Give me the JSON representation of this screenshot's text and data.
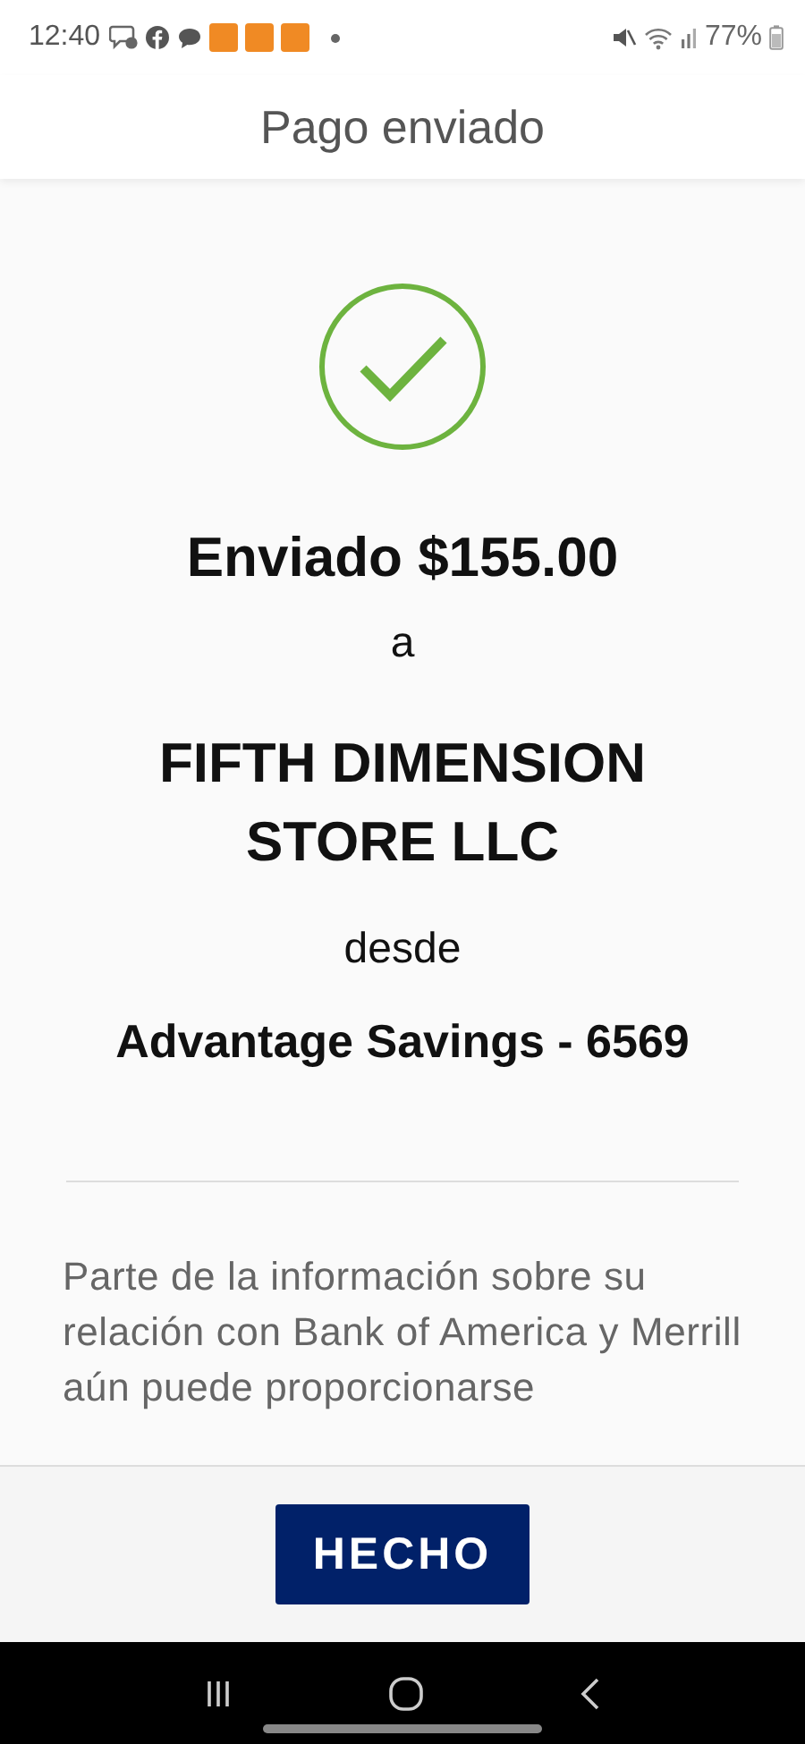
{
  "status_bar": {
    "time": "12:40",
    "battery": "77%"
  },
  "header": {
    "title": "Pago enviado"
  },
  "confirmation": {
    "amount_line": "Enviado $155.00",
    "to_word": "a",
    "payee": "FIFTH DIMENSION STORE LLC",
    "from_word": "desde",
    "account": "Advantage Savings - 6569"
  },
  "disclaimer": "Parte de la información sobre su relación con Bank of America y Merrill aún puede proporcionarse",
  "footer": {
    "button": "HECHO"
  }
}
